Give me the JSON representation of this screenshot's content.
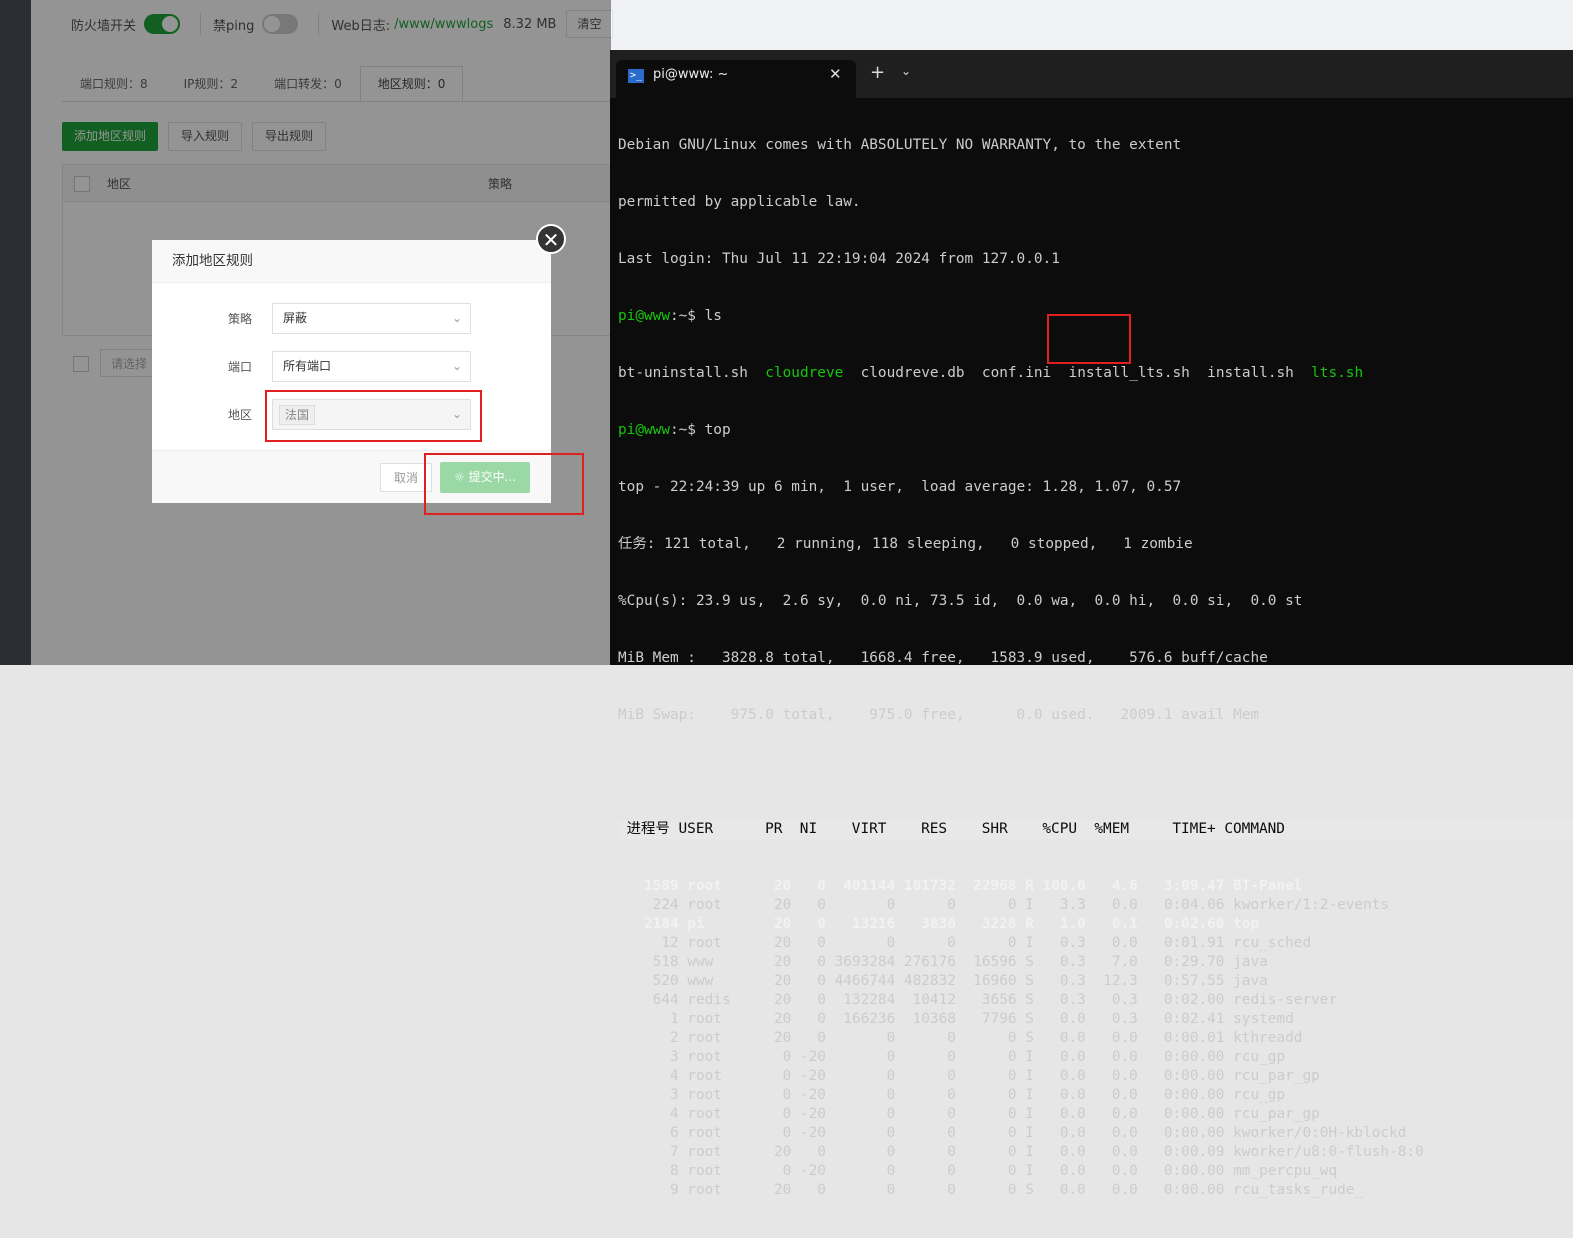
{
  "topbar": {
    "firewall_label": "防火墙开关",
    "firewall_on": true,
    "ping_label": "禁ping",
    "ping_on": false,
    "weblog_label": "Web日志:",
    "weblog_path": "/www/wwwlogs",
    "weblog_size": "8.32 MB",
    "clear_button": "清空"
  },
  "tabs": [
    {
      "label": "端口规则：8"
    },
    {
      "label": "IP规则：2"
    },
    {
      "label": "端口转发：0"
    },
    {
      "label": "地区规则：0",
      "active": true
    }
  ],
  "actions": {
    "add": "添加地区规则",
    "import": "导入规则",
    "export": "导出规则"
  },
  "table": {
    "col_region": "地区",
    "col_policy": "策略"
  },
  "bottom": {
    "select_placeholder": "请选择"
  },
  "modal": {
    "title": "添加地区规则",
    "policy_label": "策略",
    "policy_value": "屏蔽",
    "port_label": "端口",
    "port_value": "所有端口",
    "region_label": "地区",
    "region_tag": "法国",
    "cancel": "取消",
    "submit": "提交中..."
  },
  "terminal": {
    "tab_title": "pi@www: ~",
    "lines": [
      "Debian GNU/Linux comes with ABSOLUTELY NO WARRANTY, to the extent",
      "permitted by applicable law.",
      "Last login: Thu Jul 11 22:19:04 2024 from 127.0.0.1"
    ],
    "prompt_user": "pi@www",
    "prompt_path": ":~$ ",
    "cmd1": "ls",
    "ls_files": [
      {
        "name": "bt-uninstall.sh",
        "exec": false
      },
      {
        "name": "cloudreve",
        "exec": true
      },
      {
        "name": "cloudreve.db",
        "exec": false
      },
      {
        "name": "conf.ini",
        "exec": false
      },
      {
        "name": "install_lts.sh",
        "exec": false
      },
      {
        "name": "install.sh",
        "exec": false
      },
      {
        "name": "lts.sh",
        "exec": true
      }
    ],
    "cmd2": "top",
    "top_summary": [
      "top - 22:24:39 up 6 min,  1 user,  load average: 1.28, 1.07, 0.57",
      "任务: 121 total,   2 running, 118 sleeping,   0 stopped,   1 zombie",
      "%Cpu(s): 23.9 us,  2.6 sy,  0.0 ni, 73.5 id,  0.0 wa,  0.0 hi,  0.0 si,  0.0 st",
      "MiB Mem :   3828.8 total,   1668.4 free,   1583.9 used,    576.6 buff/cache",
      "MiB Swap:    975.0 total,    975.0 free,      0.0 used.   2009.1 avail Mem"
    ],
    "top_header": " 进程号 USER      PR  NI    VIRT    RES    SHR    %CPU  %MEM     TIME+ COMMAND",
    "processes": [
      {
        "line": "   1589 root      20   0  401144 181732  22968 R 100.0   4.6   3:09.47 BT-Panel",
        "bold": true
      },
      {
        "line": "    224 root      20   0       0      0      0 I   3.3   0.0   0:04.06 kworker/1:2-events",
        "bold": false
      },
      {
        "line": "   2184 pi        20   0   13216   3836   3228 R   1.0   0.1   0:02.60 top",
        "bold": true
      },
      {
        "line": "     12 root      20   0       0      0      0 I   0.3   0.0   0:01.91 rcu_sched",
        "bold": false
      },
      {
        "line": "    518 www       20   0 3693284 276176  16596 S   0.3   7.0   0:29.70 java",
        "bold": false
      },
      {
        "line": "    520 www       20   0 4466744 482832  16960 S   0.3  12.3   0:57.55 java",
        "bold": false
      },
      {
        "line": "    644 redis     20   0  132284  10412   3656 S   0.3   0.3   0:02.00 redis-server",
        "bold": false
      },
      {
        "line": "      1 root      20   0  166236  10368   7796 S   0.0   0.3   0:02.41 systemd",
        "bold": false
      },
      {
        "line": "      2 root      20   0       0      0      0 S   0.0   0.0   0:00.01 kthreadd",
        "bold": false
      },
      {
        "line": "      3 root       0 -20       0      0      0 I   0.0   0.0   0:00.00 rcu_gp",
        "bold": false
      },
      {
        "line": "      4 root       0 -20       0      0      0 I   0.0   0.0   0:00.00 rcu_par_gp",
        "bold": false
      },
      {
        "line": "      3 root       0 -20       0      0      0 I   0.0   0.0   0:00.00 rcu_gp",
        "bold": false
      },
      {
        "line": "      4 root       0 -20       0      0      0 I   0.0   0.0   0:00.00 rcu_par_gp",
        "bold": false
      },
      {
        "line": "      6 root       0 -20       0      0      0 I   0.0   0.0   0:00.00 kworker/0:0H-kblockd",
        "bold": false
      },
      {
        "line": "      7 root      20   0       0      0      0 I   0.0   0.0   0:00.09 kworker/u8:0-flush-8:0",
        "bold": false
      },
      {
        "line": "      8 root       0 -20       0      0      0 I   0.0   0.0   0:00.00 mm_percpu_wq",
        "bold": false
      },
      {
        "line": "      9 root      20   0       0      0      0 S   0.0   0.0   0:00.00 rcu_tasks_rude_",
        "bold": false
      }
    ]
  },
  "colors": {
    "brand_green": "#20a53a",
    "highlight_red": "#e0201e",
    "terminal_green": "#16c60c"
  }
}
